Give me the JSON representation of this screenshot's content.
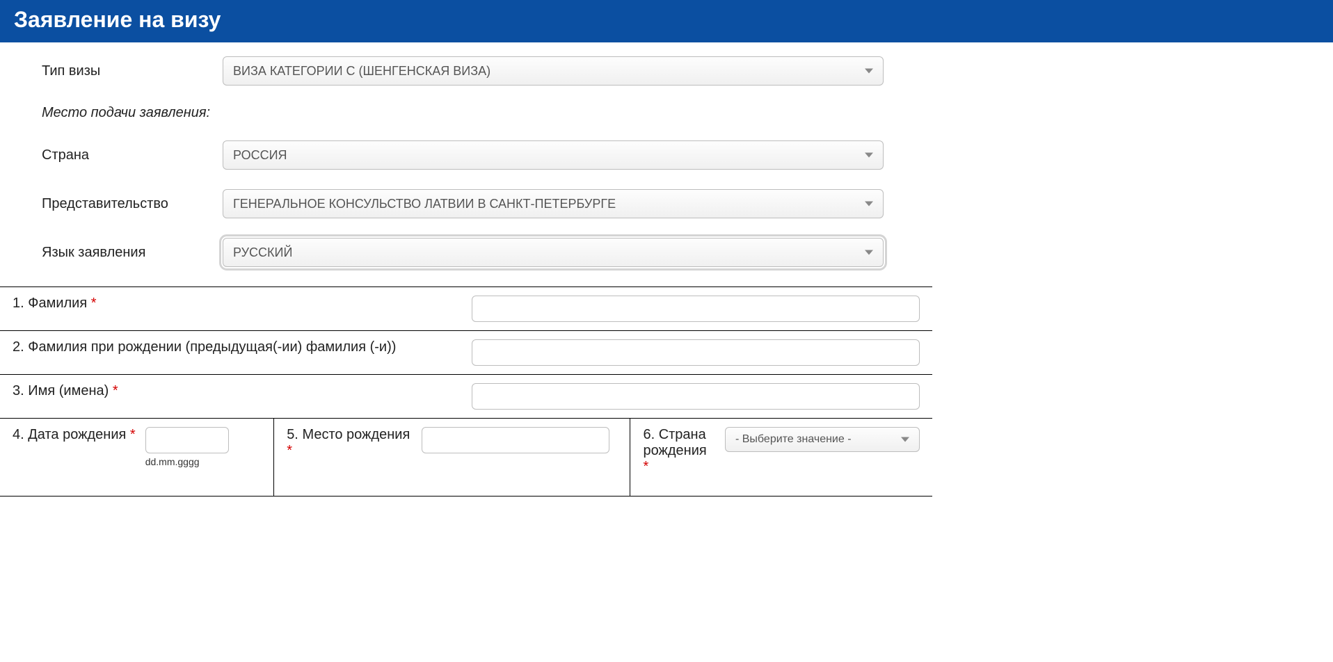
{
  "header": {
    "title": "Заявление на визу"
  },
  "top": {
    "visa_type": {
      "label": "Тип визы",
      "value": "ВИЗА КАТЕГОРИИ C (ШЕНГЕНСКАЯ ВИЗА)"
    },
    "submission_place_label": "Место подачи заявления:",
    "country": {
      "label": "Страна",
      "value": "РОССИЯ"
    },
    "mission": {
      "label": "Представительство",
      "value": "ГЕНЕРАЛЬНОЕ КОНСУЛЬСТВО ЛАТВИИ В САНКТ-ПЕТЕРБУРГЕ"
    },
    "app_language": {
      "label": "Язык заявления",
      "value": "РУССКИЙ"
    }
  },
  "fields": {
    "f1": {
      "no": "1.",
      "label": "Фамилия",
      "required": "*"
    },
    "f2": {
      "no": "2.",
      "label": "Фамилия при рождении (предыдущая(-ии) фамилия (-и))"
    },
    "f3": {
      "no": "3.",
      "label": "Имя (имена)",
      "required": "*"
    },
    "f4": {
      "no": "4.",
      "label": "Дата рождения",
      "required": "*",
      "format_hint": "dd.mm.gggg"
    },
    "f5": {
      "no": "5.",
      "label": "Место рождения",
      "required": "*"
    },
    "f6": {
      "no": "6.",
      "label": "Страна рождения",
      "required": "*",
      "placeholder": "- Выберите значение -"
    }
  }
}
